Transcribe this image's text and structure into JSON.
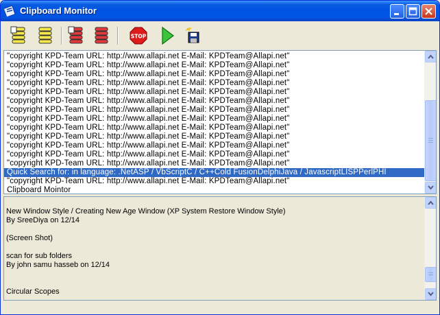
{
  "window": {
    "title": "Clipboard Monitor"
  },
  "toolbar": {
    "buttons": [
      {
        "name": "yellow-stack-icon-1"
      },
      {
        "name": "yellow-stack-icon-2"
      },
      {
        "name": "red-stack-icon-1"
      },
      {
        "name": "red-stack-icon-2"
      },
      {
        "name": "stop-icon",
        "label": "STOP"
      },
      {
        "name": "play-icon"
      },
      {
        "name": "save-icon"
      }
    ]
  },
  "clipboard_list": {
    "items": [
      "\"copyright KPD-Team URL: http://www.allapi.net  E-Mail: KPDTeam@Allapi.net\"",
      "\"copyright KPD-Team URL: http://www.allapi.net  E-Mail: KPDTeam@Allapi.net\"",
      "\"copyright KPD-Team URL: http://www.allapi.net  E-Mail: KPDTeam@Allapi.net\"",
      "\"copyright KPD-Team URL: http://www.allapi.net  E-Mail: KPDTeam@Allapi.net\"",
      "\"copyright KPD-Team URL: http://www.allapi.net  E-Mail: KPDTeam@Allapi.net\"",
      "\"copyright KPD-Team URL: http://www.allapi.net  E-Mail: KPDTeam@Allapi.net\"",
      "\"copyright KPD-Team URL: http://www.allapi.net  E-Mail: KPDTeam@Allapi.net\"",
      "\"copyright KPD-Team URL: http://www.allapi.net  E-Mail: KPDTeam@Allapi.net\"",
      "\"copyright KPD-Team URL: http://www.allapi.net  E-Mail: KPDTeam@Allapi.net\"",
      "\"copyright KPD-Team URL: http://www.allapi.net  E-Mail: KPDTeam@Allapi.net\"",
      "\"copyright KPD-Team URL: http://www.allapi.net  E-Mail: KPDTeam@Allapi.net\"",
      "\"copyright KPD-Team URL: http://www.allapi.net  E-Mail: KPDTeam@Allapi.net\"",
      "\"copyright KPD-Team URL: http://www.allapi.net  E-Mail: KPDTeam@Allapi.net\"",
      " Quick Search for:   in language: .NetASP / VbScriptC / C++Cold FusionDelphiJava / JavascriptLISPPerlPHI",
      "\"copyright KPD-Team URL: http://www.allapi.net  E-Mail: KPDTeam@Allapi.net\"",
      "Clipboard Mointor"
    ],
    "selected_index": 13
  },
  "detail_text": {
    "lines": [
      "",
      "New Window Style / Creating New Age Window (XP System Restore Window Style)",
      "By SreeDiya on 12/14",
      "",
      "(Screen Shot)",
      "",
      "scan for sub folders",
      "By john samu hasseb on 12/14",
      "",
      "",
      "Circular Scopes"
    ]
  },
  "colors": {
    "titlebar": "#0054e3",
    "selection": "#316ac5",
    "face": "#ece9d8"
  }
}
